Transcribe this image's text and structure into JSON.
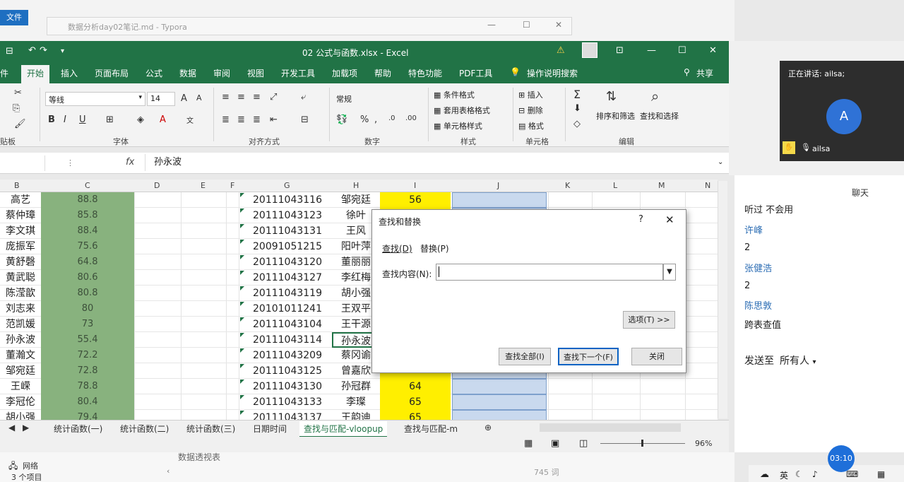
{
  "explorer": {
    "file_tab": "文件",
    "typora_title": "数据分析day02笔记.md - Typora",
    "network": "网络",
    "item_count": "3 个项目",
    "doc_title": "数据透视表",
    "word_count": "745 词"
  },
  "excel": {
    "title": "02 公式与函数.xlsx  -  Excel",
    "tabs": [
      "件",
      "开始",
      "插入",
      "页面布局",
      "公式",
      "数据",
      "审阅",
      "视图",
      "开发工具",
      "加载项",
      "帮助",
      "特色功能",
      "PDF工具"
    ],
    "search_hint": "操作说明搜索",
    "share": "共享",
    "ribbon": {
      "font_name": "等线",
      "font_size": "14",
      "number_format": "常规",
      "cond_format": "条件格式",
      "table_format": "套用表格格式",
      "cell_style": "单元格样式",
      "insert": "插入",
      "delete": "删除",
      "format": "格式",
      "sort_filter": "排序和筛选",
      "find_select": "查找和选择",
      "groups": [
        "贴板",
        "字体",
        "对齐方式",
        "数字",
        "样式",
        "单元格",
        "编辑"
      ]
    },
    "name_box": "",
    "formula": "孙永波",
    "columns": [
      "B",
      "C",
      "D",
      "E",
      "F",
      "G",
      "H",
      "I",
      "J",
      "K",
      "L",
      "M",
      "N"
    ],
    "rows": [
      {
        "name": "高艺",
        "score": "88.8",
        "id": "20111043116",
        "h": "邹宛廷",
        "i": "56"
      },
      {
        "name": "蔡仲璋",
        "score": "85.8",
        "id": "20111043123",
        "h": "徐叶",
        "i": ""
      },
      {
        "name": "李文琪",
        "score": "88.4",
        "id": "20111043131",
        "h": "王风",
        "i": ""
      },
      {
        "name": "庞振军",
        "score": "75.6",
        "id": "20091051215",
        "h": "阳叶萍",
        "i": ""
      },
      {
        "name": "黄舒磬",
        "score": "64.8",
        "id": "20111043120",
        "h": "董丽丽",
        "i": ""
      },
      {
        "name": "黄武聪",
        "score": "80.6",
        "id": "20111043127",
        "h": "李红梅",
        "i": ""
      },
      {
        "name": "陈滢歆",
        "score": "80.8",
        "id": "20111043119",
        "h": "胡小强",
        "i": ""
      },
      {
        "name": "刘志来",
        "score": "80",
        "id": "20101011241",
        "h": "王双平",
        "i": ""
      },
      {
        "name": "范凯媛",
        "score": "73",
        "id": "20111043104",
        "h": "王干源",
        "i": ""
      },
      {
        "name": "孙永波",
        "score": "55.4",
        "id": "20111043114",
        "h": "孙永波",
        "i": ""
      },
      {
        "name": "董瀚文",
        "score": "72.2",
        "id": "20111043209",
        "h": "蔡冈谕",
        "i": ""
      },
      {
        "name": "邹宛廷",
        "score": "72.8",
        "id": "20111043125",
        "h": "曾嘉欣",
        "i": ""
      },
      {
        "name": "王嵘",
        "score": "78.8",
        "id": "20111043130",
        "h": "孙冠群",
        "i": "64"
      },
      {
        "name": "李冠伦",
        "score": "80.4",
        "id": "20111043133",
        "h": "李璨",
        "i": "65"
      },
      {
        "name": "胡小强",
        "score": "79.4",
        "id": "20111043137",
        "h": "王韵迪",
        "i": "65"
      }
    ],
    "sheets": [
      "统计函数(一)",
      "统计函数(二)",
      "统计函数(三)",
      "日期时间",
      "查找与匹配-vloopup",
      "查找与匹配-m"
    ],
    "zoom": "96%"
  },
  "dialog": {
    "title": "查找和替换",
    "help": "?",
    "tab_find": "查找(D)",
    "tab_replace": "替换(P)",
    "label": "查找内容(N):",
    "value": "",
    "options": "选项(T) >>",
    "find_all": "查找全部(I)",
    "find_next": "查找下一个(F)",
    "close": "关闭"
  },
  "meeting": {
    "talking": "正在讲话: ailsa;",
    "avatar": "A",
    "user": "ailsa"
  },
  "chat": {
    "title": "聊天",
    "messages": [
      "听过 不会用",
      "许峰",
      "2",
      "张健浩",
      "2",
      "陈思敦",
      "跨表查值"
    ],
    "send_to": "发送至",
    "recipient": "所有人"
  },
  "taskbar": {
    "clock": "03:10",
    "ime": "英"
  }
}
